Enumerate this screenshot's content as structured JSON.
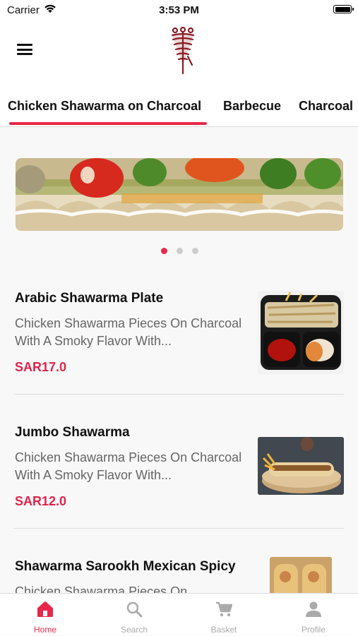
{
  "status": {
    "carrier": "Carrier",
    "time": "3:53 PM"
  },
  "header": {
    "menu_icon": "hamburger-icon",
    "logo_icon": "shawarma-logo"
  },
  "tabs": [
    {
      "label": "Chicken Shawarma on Charcoal",
      "active": true
    },
    {
      "label": "Barbecue",
      "active": false
    },
    {
      "label": "Charcoal",
      "active": false
    }
  ],
  "carousel": {
    "slides": 3,
    "active_index": 0
  },
  "items": [
    {
      "title": "Arabic Shawarma Plate",
      "desc": "Chicken Shawarma Pieces On Charcoal With A Smoky Flavor With...",
      "price": "SAR17.0"
    },
    {
      "title": "Jumbo Shawarma",
      "desc": "Chicken Shawarma Pieces On Charcoal With A Smoky Flavor With...",
      "price": "SAR12.0"
    },
    {
      "title": "Shawarma Sarookh Mexican Spicy",
      "desc": "Chicken Shawarma Pieces On",
      "price": ""
    }
  ],
  "bottom_nav": [
    {
      "label": "Home",
      "icon": "home-icon",
      "active": true
    },
    {
      "label": "Search",
      "icon": "search-icon",
      "active": false
    },
    {
      "label": "Basket",
      "icon": "cart-icon",
      "active": false
    },
    {
      "label": "Profile",
      "icon": "profile-icon",
      "active": false
    }
  ],
  "colors": {
    "accent": "#e8274a",
    "price": "#e0234a",
    "logo": "#8a1c24"
  }
}
